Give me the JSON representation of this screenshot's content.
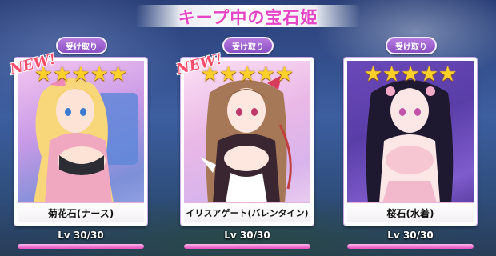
{
  "header": {
    "title": "キープ中の宝石姫"
  },
  "cards": [
    {
      "button_label": "受け取り",
      "badge": "NEW!",
      "stars": "★★★★★",
      "star_count": 5,
      "name": "菊花石(ナース)",
      "level_text": "Lv 30/30",
      "level_progress": 1.0,
      "theme_color": "#d89ae8"
    },
    {
      "button_label": "受け取り",
      "badge": "NEW!",
      "stars": "★★★★★",
      "star_count": 5,
      "name": "イリスアゲート(バレンタイン)",
      "level_text": "Lv 30/30",
      "level_progress": 1.0,
      "theme_color": "#e6a8e6"
    },
    {
      "button_label": "受け取り",
      "badge": "",
      "stars": "★★★★★",
      "star_count": 5,
      "name": "桜石(水着)",
      "level_text": "Lv 30/30",
      "level_progress": 1.0,
      "theme_color": "#7a5ac8"
    }
  ],
  "colors": {
    "title_pink": "#e544c6",
    "button_purple": "#8a4fc2",
    "star_gold": "#ffd02a",
    "badge_red": "#ff4d6a",
    "level_pink": "#e54fbf"
  }
}
